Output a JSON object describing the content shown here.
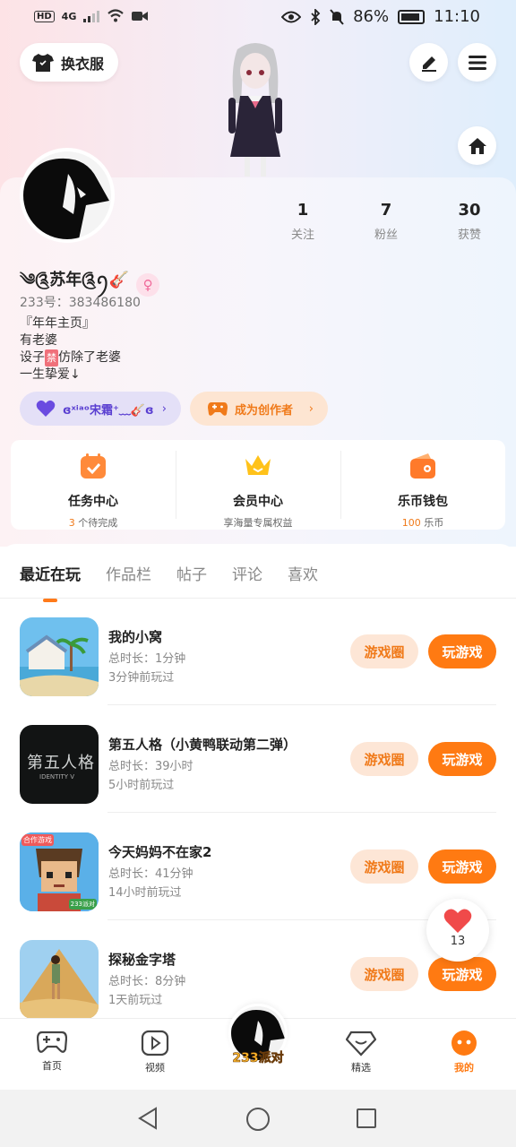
{
  "status_bar": {
    "network_badge": "HD",
    "network_type": "4G",
    "battery": "86%",
    "time": "11:10"
  },
  "header": {
    "wardrobe_label": "换衣服"
  },
  "profile": {
    "stats": [
      {
        "num": "1",
        "label": "关注"
      },
      {
        "num": "7",
        "label": "粉丝"
      },
      {
        "num": "30",
        "label": "获赞"
      }
    ],
    "nickname": "༄༊苏年༊ꪆ🎸",
    "gender_symbol": "♀",
    "uid": "233号：383486180",
    "bio": {
      "line1": "『年年主页』",
      "line2": "有老婆",
      "line3_pre": "设子",
      "line3_badge": "禁",
      "line3_post": "仿除了老婆",
      "line4": "一生挚爱↓"
    },
    "chip_friend": "ɞˣⁱᵃᵒ宋霜⁺﹏🎸ɞ",
    "chip_creator": "成为创作者"
  },
  "services": [
    {
      "title": "任务中心",
      "sub_num": "3",
      "sub_text": " 个待完成"
    },
    {
      "title": "会员中心",
      "sub_num": "",
      "sub_text": "享海量专属权益"
    },
    {
      "title": "乐币钱包",
      "sub_num": "100",
      "sub_text": " 乐币"
    }
  ],
  "tabs": [
    "最近在玩",
    "作品栏",
    "帖子",
    "评论",
    "喜欢"
  ],
  "games": [
    {
      "name": "我的小窝",
      "duration": "总时长：1分钟",
      "ago": "3分钟前玩过"
    },
    {
      "name": "第五人格（小黄鸭联动第二弹）",
      "duration": "总时长：39小时",
      "ago": "5小时前玩过"
    },
    {
      "name": "今天妈妈不在家2",
      "duration": "总时长：41分钟",
      "ago": "14小时前玩过"
    },
    {
      "name": "探秘金字塔",
      "duration": "总时长：8分钟",
      "ago": "1天前玩过"
    }
  ],
  "game_actions": {
    "circle_label": "游戏圈",
    "play_label": "玩游戏"
  },
  "thumb_texts": {
    "game2": "第五人格",
    "game2_sub": "IDENTITY V",
    "game3_tag": "合作游戏",
    "game3_tag2": "233派对"
  },
  "fab": {
    "count": "13"
  },
  "bottom_nav": {
    "home": "首页",
    "video": "视频",
    "party": "233派对",
    "featured": "精选",
    "mine": "我的"
  },
  "colors": {
    "accent": "#ff7a12",
    "accent_light": "#fde6d6",
    "purple": "#5a3fd1"
  }
}
